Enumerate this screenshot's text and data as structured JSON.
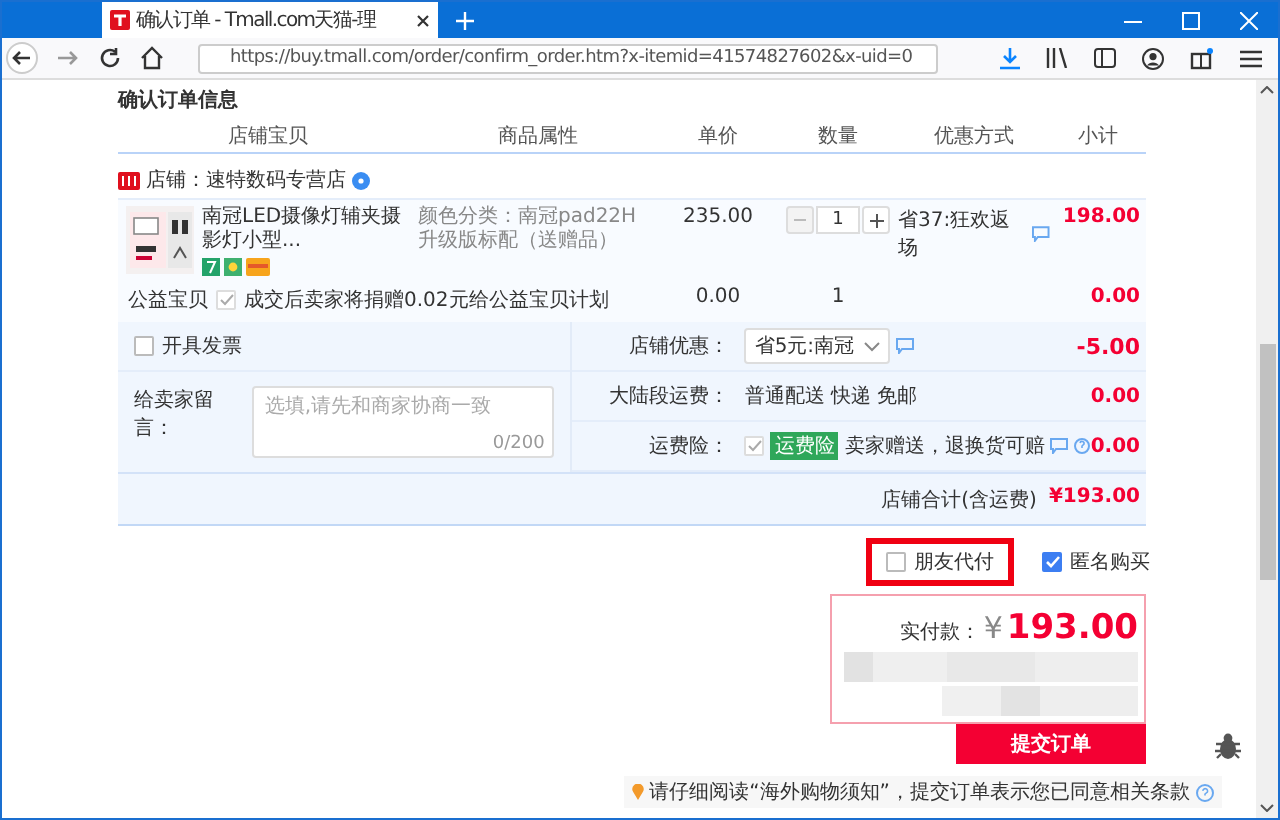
{
  "browser": {
    "tab_title": "确认订单 - Tmall.com天猫-理",
    "url": "https://buy.tmall.com/order/confirm_order.htm?x-itemid=41574827602&x-uid=0"
  },
  "page_title": "确认订单信息",
  "columns": [
    "店铺宝贝",
    "商品属性",
    "单价",
    "数量",
    "优惠方式",
    "小计"
  ],
  "store": {
    "label": "店铺：速特数码专营店"
  },
  "item": {
    "name": "南冠LED摄像灯辅夹摄影灯小型...",
    "attributes": "颜色分类：南冠pad22H升级版标配（送赠品）",
    "price": "235.00",
    "quantity": "1",
    "discount": "省37:狂欢返场",
    "subtotal": "198.00"
  },
  "charity": {
    "label": "公益宝贝",
    "checked": true,
    "description": "成交后卖家将捐赠0.02元给公益宝贝计划",
    "price": "0.00",
    "quantity": "1",
    "subtotal": "0.00"
  },
  "invoice": {
    "label": "开具发票",
    "checked": false
  },
  "message": {
    "label": "给卖家留言：",
    "placeholder": "选填,请先和商家协商一致",
    "counter": "0/200"
  },
  "options": [
    {
      "kind": "select",
      "label": "店铺优惠：",
      "value": "省5元:南冠",
      "amount": "-5.00"
    },
    {
      "kind": "text",
      "label": "大陆段运费：",
      "value": "普通配送 快递 免邮",
      "amount": "0.00"
    },
    {
      "kind": "insurance",
      "label": "运费险：",
      "checked": true,
      "badge": "运费险",
      "value": "卖家赠送，退换货可赔",
      "amount": "0.00"
    }
  ],
  "store_total": {
    "label": "店铺合计(含运费)",
    "amount": "¥193.00"
  },
  "pay_options": [
    {
      "label": "朋友代付",
      "checked": false,
      "highlighted": true
    },
    {
      "label": "匿名购买",
      "checked": true,
      "highlighted": false
    }
  ],
  "payment": {
    "label": "实付款：",
    "currency": "¥",
    "amount": "193.00"
  },
  "submit": "提交订单",
  "notice": "请仔细阅读“海外购物须知”，提交订单表示您已同意相关条款"
}
